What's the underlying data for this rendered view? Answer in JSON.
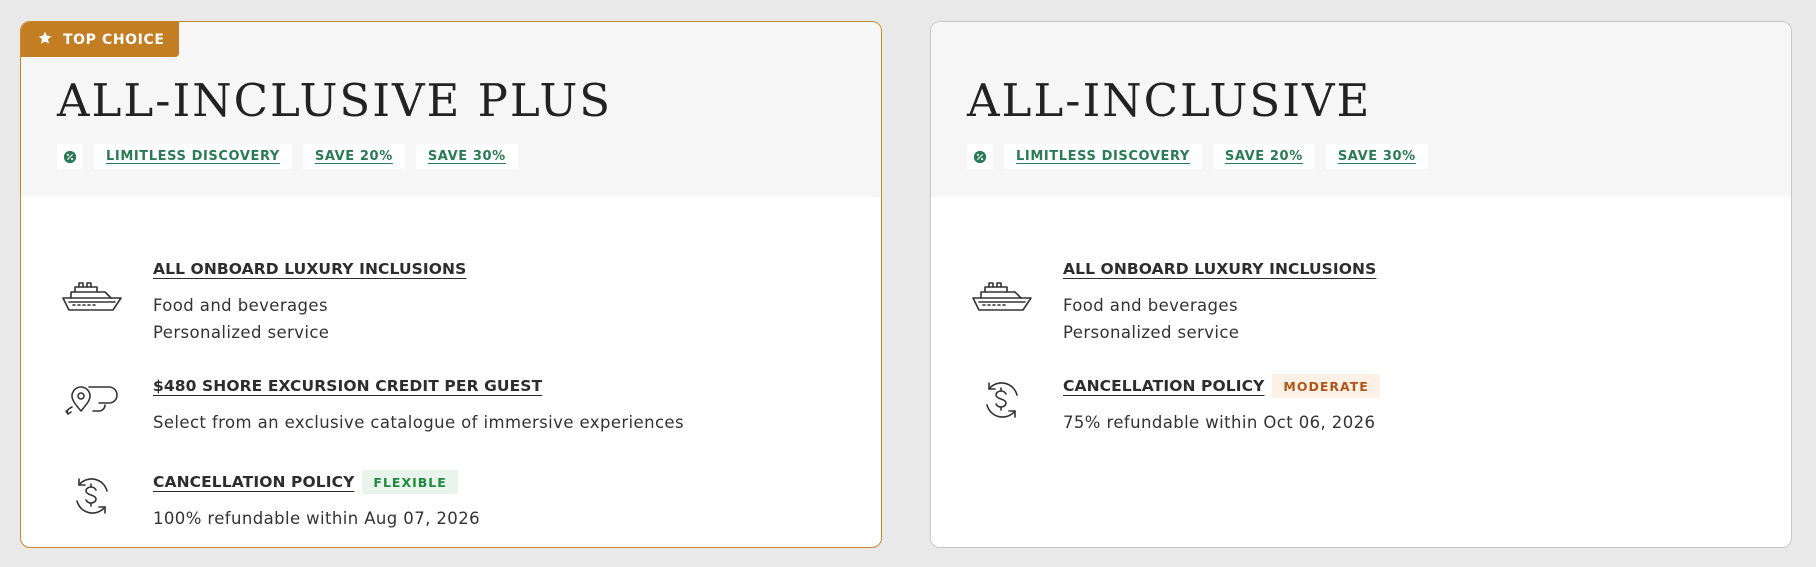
{
  "colors": {
    "page_bg": "#e9e9e9",
    "accent_gold": "#c37d22",
    "tag_green": "#2a7a56",
    "flexible_green": "#1f8a3e",
    "moderate_orange": "#b0561c"
  },
  "cards": [
    {
      "badge": "TOP CHOICE",
      "badge_icon": "star-icon",
      "title": "ALL-INCLUSIVE PLUS",
      "tags": [
        "LIMITLESS DISCOVERY",
        "SAVE 20%",
        "SAVE 30%"
      ],
      "features": [
        {
          "icon": "ship-icon",
          "heading": "ALL ONBOARD LUXURY INCLUSIONS",
          "lines": [
            "Food and beverages",
            "Personalized service"
          ]
        },
        {
          "icon": "excursion-route-icon",
          "heading": "$480 SHORE EXCURSION CREDIT PER GUEST",
          "lines": [
            "Select from an exclusive catalogue of immersive experiences"
          ]
        },
        {
          "icon": "refund-dollar-icon",
          "heading": "CANCELLATION POLICY",
          "pill": "FLEXIBLE",
          "lines": [
            "100% refundable within Aug 07, 2026"
          ]
        }
      ]
    },
    {
      "title": "ALL-INCLUSIVE",
      "tags": [
        "LIMITLESS DISCOVERY",
        "SAVE 20%",
        "SAVE 30%"
      ],
      "features": [
        {
          "icon": "ship-icon",
          "heading": "ALL ONBOARD LUXURY INCLUSIONS",
          "lines": [
            "Food and beverages",
            "Personalized service"
          ]
        },
        {
          "icon": "refund-dollar-icon",
          "heading": "CANCELLATION POLICY",
          "pill": "MODERATE",
          "lines": [
            "75% refundable within Oct 06, 2026"
          ]
        }
      ]
    }
  ]
}
